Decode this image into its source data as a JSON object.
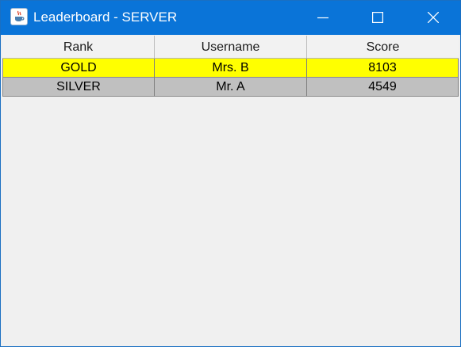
{
  "window": {
    "title": "Leaderboard - SERVER",
    "icon": "java-cup-icon"
  },
  "titlebar_buttons": {
    "minimize": "minimize-icon",
    "maximize": "maximize-icon",
    "close": "close-icon"
  },
  "table": {
    "columns": [
      "Rank",
      "Username",
      "Score"
    ],
    "rows": [
      {
        "rank": "GOLD",
        "username": "Mrs. B",
        "score": "8103",
        "color": "#ffff00"
      },
      {
        "rank": "SILVER",
        "username": "Mr. A",
        "score": "4549",
        "color": "#c0c0c0"
      }
    ]
  },
  "colors": {
    "titlebar": "#0a74d8",
    "window_bg": "#f0f0f0"
  }
}
